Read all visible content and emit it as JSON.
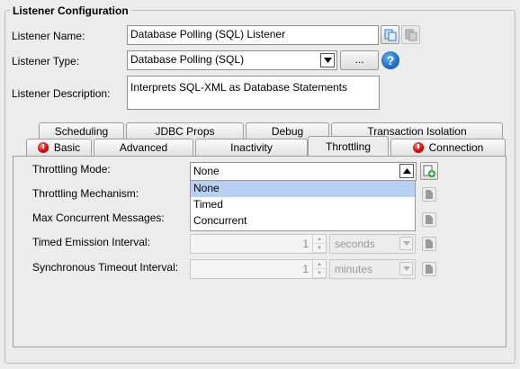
{
  "group_title": "Listener Configuration",
  "listener_name": {
    "label": "Listener Name:",
    "value": "Database Polling (SQL) Listener"
  },
  "listener_type": {
    "label": "Listener Type:",
    "value": "Database Polling (SQL)",
    "more_button": "..."
  },
  "listener_description": {
    "label": "Listener Description:",
    "value": "Interprets SQL-XML as Database Statements"
  },
  "tabs_row1": [
    "Scheduling",
    "JDBC Props",
    "Debug",
    "Transaction Isolation"
  ],
  "tabs_row2": [
    "Basic",
    "Advanced",
    "Inactivity",
    "Throttling",
    "Connection"
  ],
  "selected_tab": "Throttling",
  "throttling": {
    "mode_label": "Throttling Mode:",
    "mode_value": "None",
    "mechanism_label": "Throttling Mechanism:",
    "max_concurrent_label": "Max Concurrent Messages:",
    "timed_emission_label": "Timed Emission Interval:",
    "timed_emission_value": "1",
    "timed_emission_unit": "seconds",
    "sync_timeout_label": "Synchronous Timeout Interval:",
    "sync_timeout_value": "1",
    "sync_timeout_unit": "minutes"
  },
  "mode_dropdown_options": [
    "None",
    "Timed",
    "Concurrent"
  ],
  "mode_dropdown_highlighted": "None",
  "colors": {
    "highlight": "#b8d1f3",
    "help_icon": "#1e6fc2",
    "error_dot": "#d00000"
  }
}
